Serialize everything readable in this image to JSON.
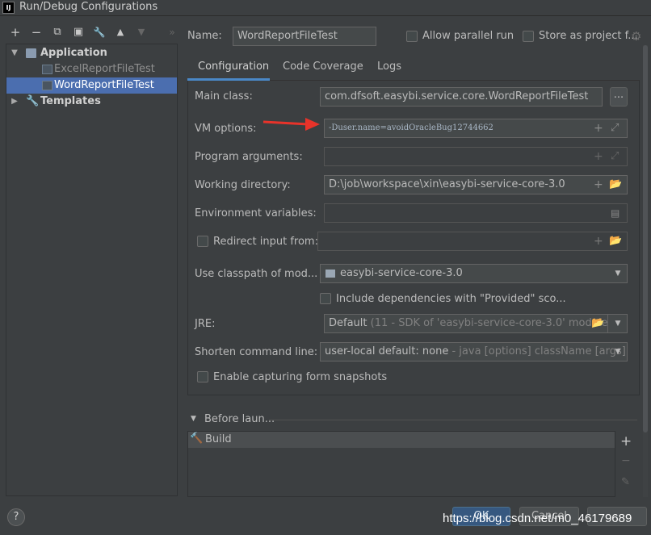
{
  "window": {
    "title": "Run/Debug Configurations",
    "logo_text": "IJ"
  },
  "toolbar": {
    "add_icon": "+",
    "remove_icon": "−",
    "copy_icon": "⧉",
    "save_icon": "▣",
    "wrench_icon": "🔧",
    "up_icon": "▲",
    "down_icon": "▼",
    "more_icon": "»"
  },
  "tree": {
    "application": "Application",
    "excel": "ExcelReportFileTest",
    "word": "WordReportFileTest",
    "templates": "Templates"
  },
  "name": {
    "label": "Name:",
    "value": "WordReportFileTest"
  },
  "options": {
    "parallel": "Allow parallel run",
    "store": "Store as project f..."
  },
  "tabs": [
    "Configuration",
    "Code Coverage",
    "Logs"
  ],
  "form": {
    "main_class_label": "Main class:",
    "main_class_value": "com.dfsoft.easybi.service.core.WordReportFileTest",
    "browse": "...",
    "vm_label": "VM options:",
    "vm_value": "-Duser.name=avoidOracleBug12744662",
    "prog_label": "Program arguments:",
    "workdir_label": "Working directory:",
    "workdir_value": "D:\\job\\workspace\\xin\\easybi-service-core-3.0",
    "env_label": "Environment variables:",
    "redirect_label": "Redirect input from:",
    "classpath_label": "Use classpath of mod...",
    "classpath_value": "easybi-service-core-3.0",
    "include_deps": "Include dependencies with \"Provided\" sco...",
    "jre_label": "JRE:",
    "jre_value": "Default",
    "jre_hint": "(11 - SDK of 'easybi-service-core-3.0' module)",
    "shorten_label": "Shorten command line:",
    "shorten_value": "user-local default: none",
    "shorten_hint": "- java [options] className [args]",
    "snapshots_label": "Enable capturing form snapshots"
  },
  "before_launch": {
    "label": "Before laun...",
    "build": "Build"
  },
  "footer": {
    "help": "?",
    "ok": "OK",
    "cancel": "Cancel"
  },
  "watermark": "https://blog.csdn.net/m0_46179689",
  "colors": {
    "accent": "#4a88c7",
    "selection": "#4b6eaf",
    "arrow": "#e8332a"
  }
}
